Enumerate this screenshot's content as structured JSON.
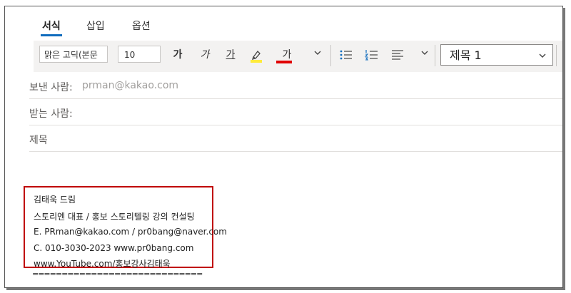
{
  "tabs": [
    {
      "label": "서식"
    },
    {
      "label": "삽입"
    },
    {
      "label": "옵션"
    }
  ],
  "toolbar": {
    "font_name": "맑은 고딕(본문",
    "font_size": "10",
    "bold_label": "가",
    "italic_label": "가",
    "underline_label": "가",
    "font_color_label": "가",
    "highlight_color": "#ffeb3b",
    "font_color": "#e00000",
    "style_value": "제목 1"
  },
  "fields": {
    "from_label": "보낸 사람:",
    "from_value": "prman@kakao.com",
    "to_label": "받는 사람:",
    "subject_label": "제목"
  },
  "signature": {
    "lines": [
      "김태욱 드림",
      "스토리엔 대표 / 홍보 스토리텔링 강의 컨설팅",
      "E. PRman@kakao.com / pr0bang@naver.com",
      "C. 010-3030-2023 www.pr0bang.com",
      "www.YouTube.com/홍보강사김태욱"
    ],
    "divider": "============================="
  },
  "colors": {
    "accent": "#0f6cbd",
    "highlight_box": "#c00000"
  }
}
